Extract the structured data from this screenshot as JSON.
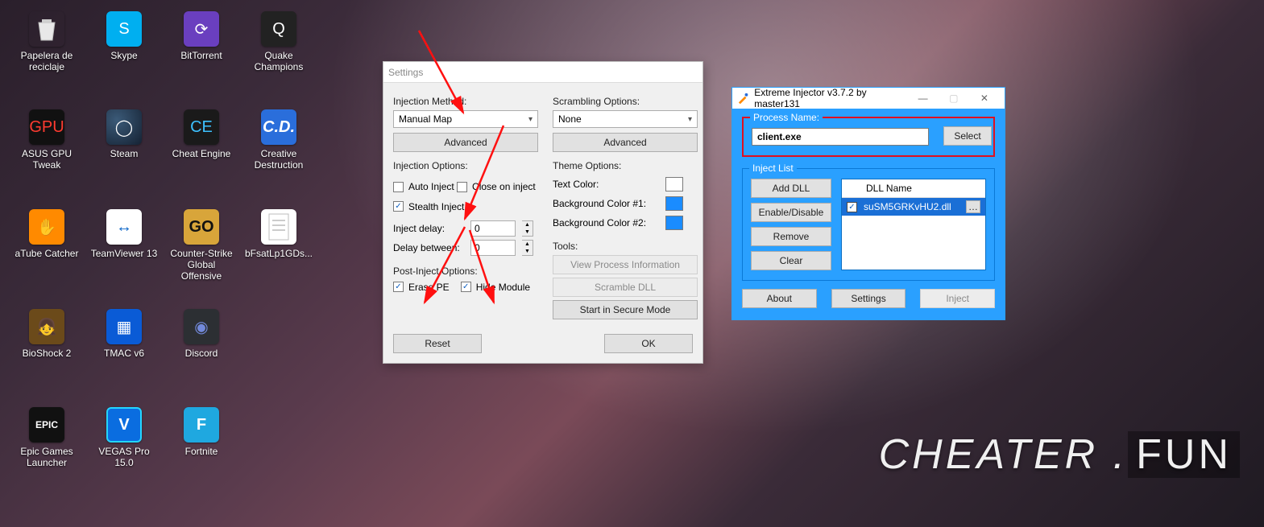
{
  "watermark": {
    "left": "CHEATER",
    "dot": " .",
    "right": "FUN"
  },
  "desktop_icons": [
    {
      "label": "Papelera de\nreciclaje"
    },
    {
      "label": "Skype"
    },
    {
      "label": "BitTorrent"
    },
    {
      "label": "Quake\nChampions"
    },
    {
      "label": "ASUS GPU Tweak"
    },
    {
      "label": "Steam"
    },
    {
      "label": "Cheat Engine"
    },
    {
      "label": "Creative\nDestruction"
    },
    {
      "label": "aTube Catcher"
    },
    {
      "label": "TeamViewer 13"
    },
    {
      "label": "Counter-Strike\nGlobal Offensive"
    },
    {
      "label": "bFsatLp1GDs..."
    },
    {
      "label": "BioShock 2"
    },
    {
      "label": "TMAC v6"
    },
    {
      "label": "Discord"
    },
    {
      "label": "Epic Games\nLauncher"
    },
    {
      "label": "VEGAS Pro 15.0"
    },
    {
      "label": "Fortnite"
    }
  ],
  "settings": {
    "title": "Settings",
    "injection_method_label": "Injection Method:",
    "injection_method_value": "Manual Map",
    "advanced": "Advanced",
    "scrambling_label": "Scrambling Options:",
    "scrambling_value": "None",
    "injection_options_label": "Injection Options:",
    "auto_inject": "Auto Inject",
    "auto_inject_checked": false,
    "close_on_inject": "Close on inject",
    "close_on_inject_checked": false,
    "stealth_inject": "Stealth Inject",
    "stealth_inject_checked": true,
    "inject_delay_label": "Inject delay:",
    "inject_delay_value": "0",
    "delay_between_label": "Delay between:",
    "delay_between_value": "0",
    "post_inject_label": "Post-Inject Options:",
    "erase_pe": "Erase PE",
    "erase_pe_checked": true,
    "hide_module": "Hide Module",
    "hide_module_checked": true,
    "theme_label": "Theme Options:",
    "text_color_label": "Text Color:",
    "text_color": "#ffffff",
    "bg1_label": "Background Color #1:",
    "bg1": "#1a8cff",
    "bg2_label": "Background Color #2:",
    "bg2": "#1a8cff",
    "tools_label": "Tools:",
    "view_proc": "View Process Information",
    "scramble_dll": "Scramble DLL",
    "secure_mode": "Start in Secure Mode",
    "reset": "Reset",
    "ok": "OK"
  },
  "injector": {
    "title": "Extreme Injector v3.7.2 by master131",
    "process_name_label": "Process Name:",
    "process_name_value": "client.exe",
    "select": "Select",
    "inject_list_label": "Inject List",
    "add_dll": "Add DLL",
    "enable_disable": "Enable/Disable",
    "remove": "Remove",
    "clear": "Clear",
    "dll_header": "DLL Name",
    "dll_item": "suSM5GRKvHU2.dll",
    "dll_checked": true,
    "about": "About",
    "settings": "Settings",
    "inject": "Inject"
  }
}
